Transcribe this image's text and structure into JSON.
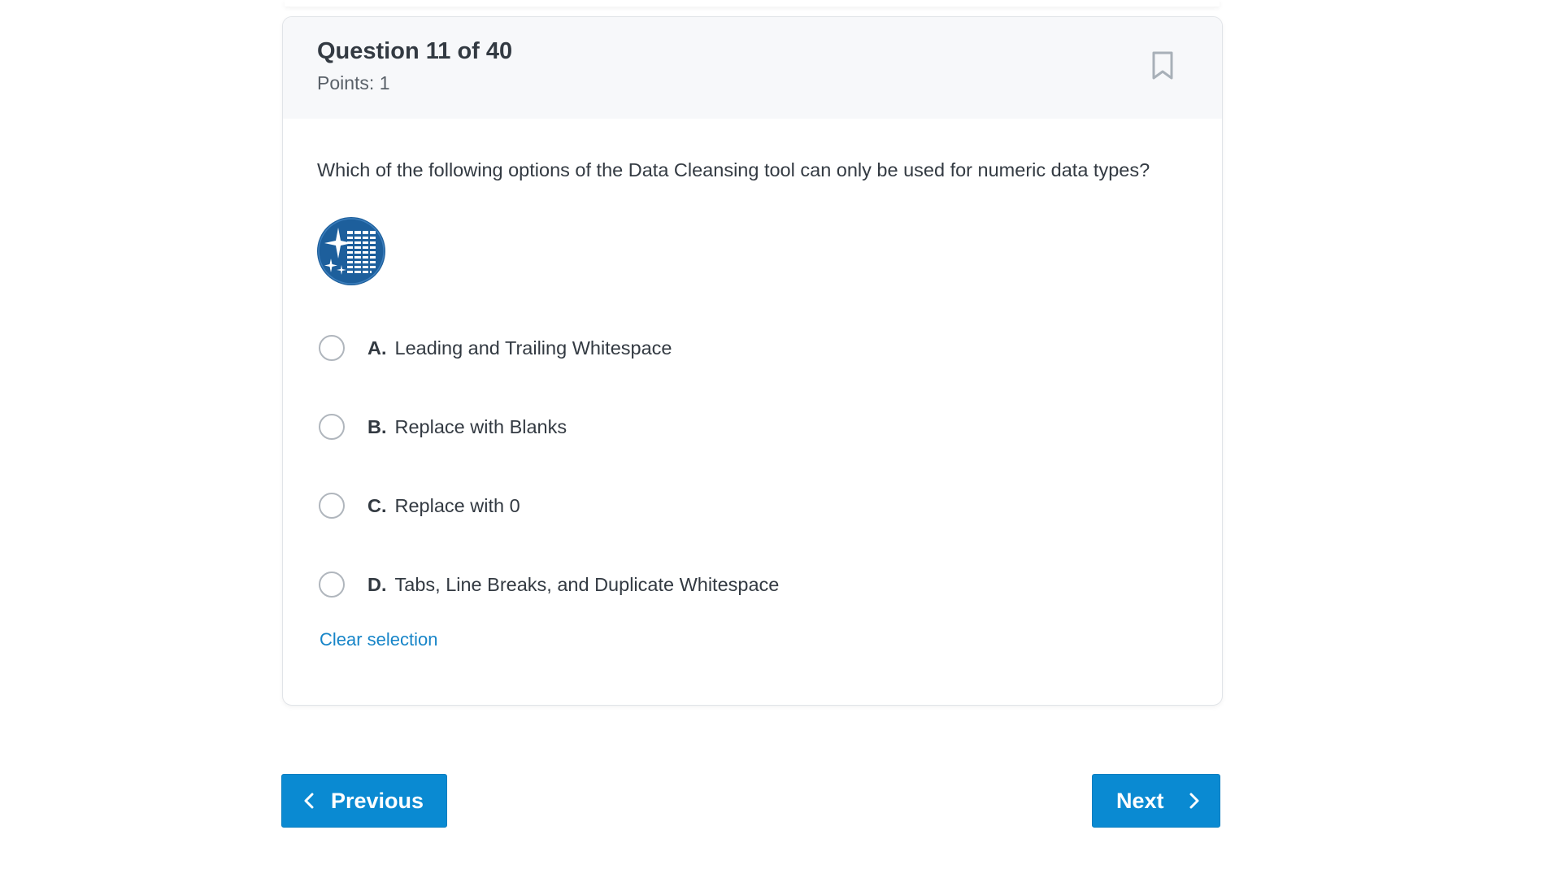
{
  "question": {
    "title": "Question 11 of 40",
    "points": "Points: 1",
    "text": "Which of the following options of the Data Cleansing tool can only be used for numeric data types?",
    "bookmark_icon": "bookmark-icon",
    "tool_icon": "data-cleansing-tool-icon"
  },
  "options": [
    {
      "letter": "A.",
      "text": "Leading and Trailing Whitespace"
    },
    {
      "letter": "B.",
      "text": "Replace with Blanks"
    },
    {
      "letter": "C.",
      "text": "Replace with 0"
    },
    {
      "letter": "D.",
      "text": "Tabs, Line Breaks, and Duplicate Whitespace"
    }
  ],
  "clear_selection": "Clear selection",
  "navigation": {
    "previous_label": "Previous",
    "next_label": "Next"
  },
  "colors": {
    "primary_button": "#0a8ad2",
    "link": "#1785c8",
    "tool_icon_blue": "#1d5f9c"
  }
}
